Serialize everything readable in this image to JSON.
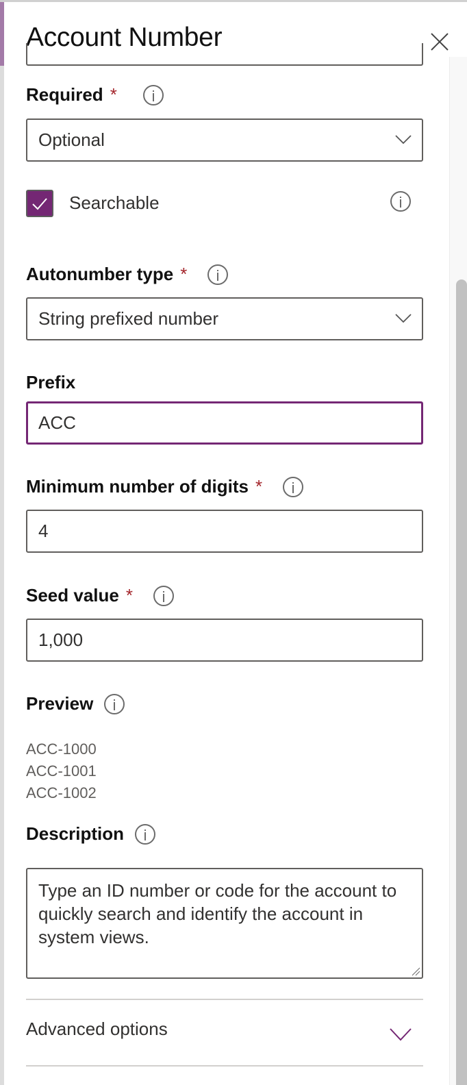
{
  "panel": {
    "title": "Account Number",
    "close_label": "Close"
  },
  "colors": {
    "accent": "#742774",
    "required": "#a4262c",
    "border": "#605e5c"
  },
  "fields": {
    "required": {
      "label": "Required",
      "required_marker": "*",
      "value": "Optional"
    },
    "searchable": {
      "label": "Searchable",
      "checked": true
    },
    "autonumber_type": {
      "label": "Autonumber type",
      "required_marker": "*",
      "value": "String prefixed number"
    },
    "prefix": {
      "label": "Prefix",
      "value": "ACC"
    },
    "min_digits": {
      "label": "Minimum number of digits",
      "required_marker": "*",
      "value": "4"
    },
    "seed_value": {
      "label": "Seed value",
      "required_marker": "*",
      "value": "1,000"
    },
    "preview": {
      "label": "Preview",
      "values": [
        "ACC-1000",
        "ACC-1001",
        "ACC-1002"
      ]
    },
    "description": {
      "label": "Description",
      "value": "Type an ID number or code for the account to quickly search and identify the account in system views."
    }
  },
  "advanced_options": {
    "label": "Advanced options"
  }
}
